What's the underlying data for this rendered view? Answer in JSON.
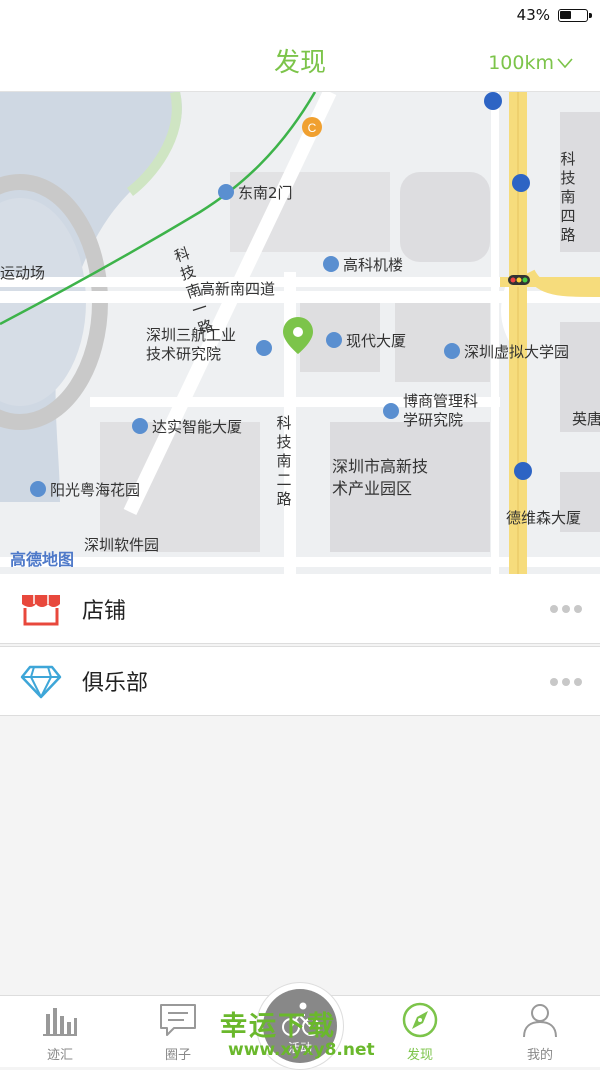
{
  "status_bar": {
    "battery": "43%",
    "battery_level": 0.43
  },
  "header": {
    "title": "发现",
    "distance": "100km"
  },
  "map": {
    "labels": {
      "dongnan2men": "东南2门",
      "gaoke": "高科机楼",
      "gaoxin_nan4": "高新南四道",
      "sanhang": "深圳三航工业\n技术研究院",
      "xiandai": "现代大厦",
      "xuni": "深圳虚拟大学园",
      "boshang": "博商管理科\n学研究院",
      "dashi": "达实智能大厦",
      "gaoxin_park": "深圳市高新技\n术产业园区",
      "yangguang": "阳光粤海花园",
      "ruanjian": "深圳软件园",
      "dewei": "德维森大厦",
      "keji_nan4": "科技南四路",
      "keji_nan1": "科技南一路",
      "keji_nan2": "科技南二路",
      "stadium": "运动场",
      "ying": "英唐",
      "logo": "高德地图"
    }
  },
  "list": {
    "items": [
      {
        "label": "店铺",
        "icon": "shop-icon"
      },
      {
        "label": "俱乐部",
        "icon": "diamond-icon"
      }
    ]
  },
  "tabbar": {
    "items": [
      {
        "label": "迹汇",
        "icon": "bar-chart-icon"
      },
      {
        "label": "圈子",
        "icon": "chat-icon"
      },
      {
        "label": "发现",
        "icon": "compass-icon"
      },
      {
        "label": "我的",
        "icon": "user-icon"
      }
    ],
    "center_label": "活动"
  },
  "watermark": {
    "line1": "幸运下载",
    "line2": "www.xyxy8.net"
  },
  "colors": {
    "accent": "#7cc44a",
    "road_major": "#f6dc7c",
    "route": "#3db34a"
  }
}
